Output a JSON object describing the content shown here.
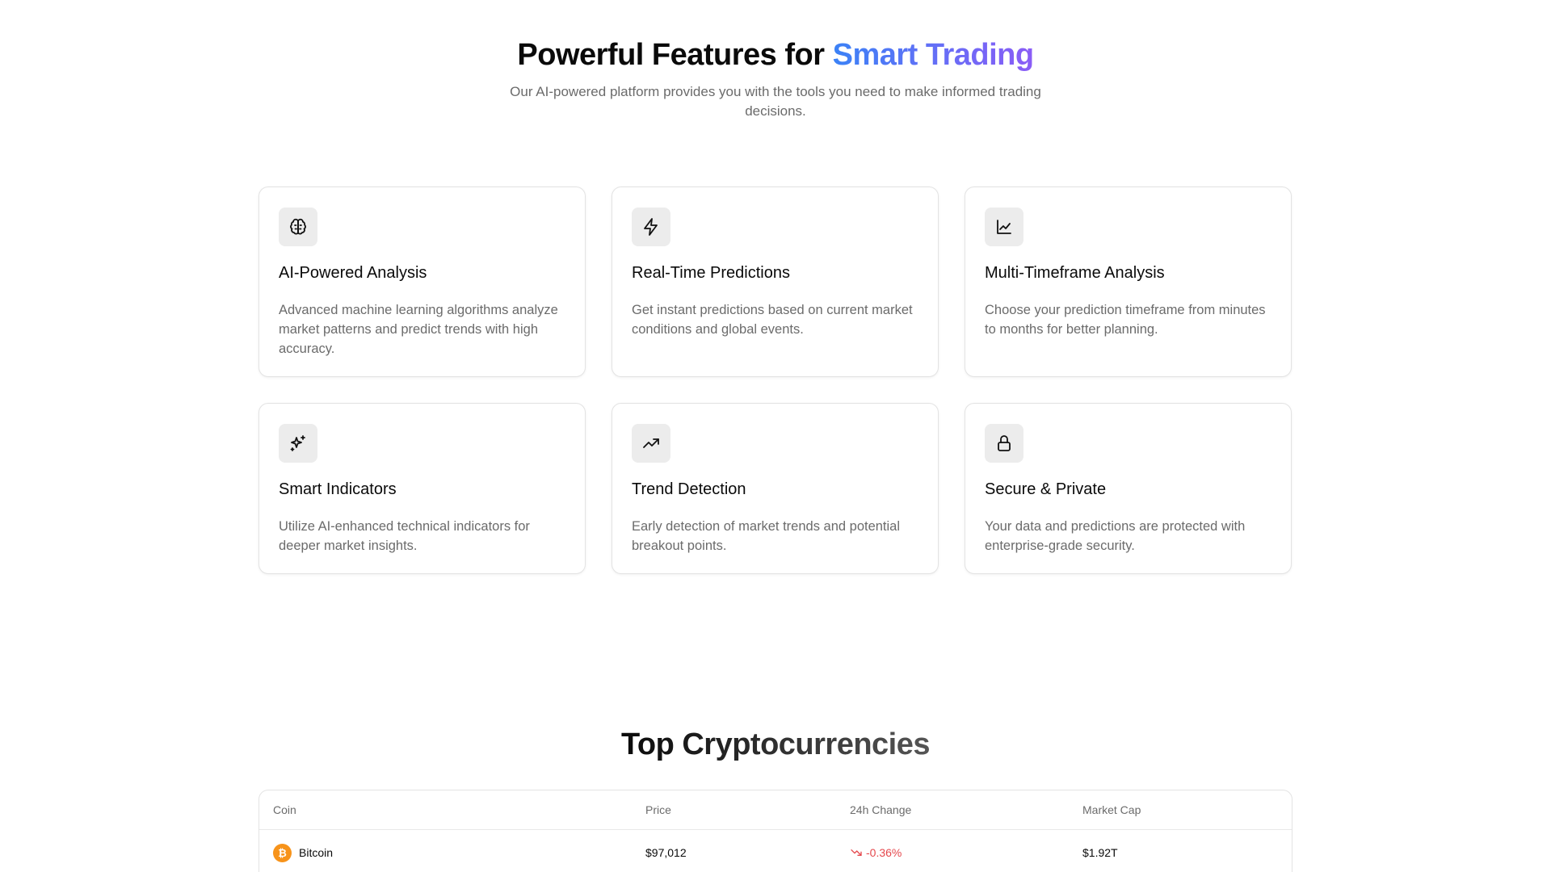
{
  "features": {
    "title_prefix": "Powerful Features for ",
    "title_highlight": "Smart Trading",
    "subtitle": "Our AI-powered platform provides you with the tools you need to make informed trading decisions.",
    "cards": [
      {
        "icon": "brain-icon",
        "title": "AI-Powered Analysis",
        "description": "Advanced machine learning algorithms analyze market patterns and predict trends with high accuracy."
      },
      {
        "icon": "lightning-icon",
        "title": "Real-Time Predictions",
        "description": "Get instant predictions based on current market conditions and global events."
      },
      {
        "icon": "line-chart-icon",
        "title": "Multi-Timeframe Analysis",
        "description": "Choose your prediction timeframe from minutes to months for better planning."
      },
      {
        "icon": "sparkles-icon",
        "title": "Smart Indicators",
        "description": "Utilize AI-enhanced technical indicators for deeper market insights."
      },
      {
        "icon": "trending-up-icon",
        "title": "Trend Detection",
        "description": "Early detection of market trends and potential breakout points."
      },
      {
        "icon": "lock-icon",
        "title": "Secure & Private",
        "description": "Your data and predictions are protected with enterprise-grade security."
      }
    ]
  },
  "crypto": {
    "title": "Top Cryptocurrencies",
    "columns": [
      "Coin",
      "Price",
      "24h Change",
      "Market Cap"
    ],
    "rows": [
      {
        "icon": "bitcoin-icon",
        "symbol": "₿",
        "name": "Bitcoin",
        "price": "$97,012",
        "change": "-0.36%",
        "market_cap": "$1.92T"
      }
    ]
  },
  "colors": {
    "gradient_start": "#3b82f6",
    "gradient_end": "#8b5cf6",
    "negative": "#e5484d",
    "bitcoin": "#f7931a"
  }
}
